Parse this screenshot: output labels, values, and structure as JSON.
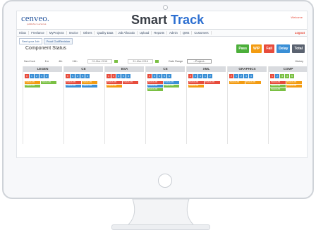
{
  "app": {
    "logo": "cenveo.",
    "logo_sub": "publisher services",
    "title_prefix": "Smart",
    "title_suffix": "Track",
    "user": "Welcome"
  },
  "menu": [
    "Inbox",
    "Freelance",
    "MyProjects",
    "Invoice",
    "Others",
    "Quality Data",
    "Job Allocatio",
    "Upload",
    "Reports",
    "Admin",
    "QMS",
    "Customers"
  ],
  "logout": "Logout",
  "tabs": [
    "Sent your Job",
    "Proof Out/Revision"
  ],
  "section_title": "Component Status",
  "status_buttons": [
    {
      "label": "Pass",
      "color": "#4caf3a"
    },
    {
      "label": "WIP",
      "color": "#f39c12"
    },
    {
      "label": "Fail",
      "color": "#e74c3c"
    },
    {
      "label": "Delay",
      "color": "#3a8fd6"
    },
    {
      "label": "Total",
      "color": "#5a6270"
    }
  ],
  "filters": {
    "f1": "Next 1wk",
    "f2": "1hr",
    "f3": "4th",
    "f4": "11th",
    "date_from": "01-Mar-2016",
    "date_to": "31-Mar-2016",
    "range_label": "Date Range",
    "project_select": "--Project--",
    "history": "History"
  },
  "columns": [
    {
      "name": "LEGEN",
      "nums": [
        "0",
        "1",
        "2",
        "1",
        "2"
      ],
      "num_colors": [
        "#e74c3c",
        "#3a8fd6",
        "#3a8fd6",
        "#3a8fd6",
        "#3a8fd6"
      ],
      "cards": [
        {
          "t": "TRACK-PR",
          "c": "#f39c12"
        },
        {
          "t": "TRACK-PR",
          "c": "#7ac043"
        },
        {
          "t": "TRACK-PR",
          "c": "#7ac043"
        }
      ]
    },
    {
      "name": "CE",
      "nums": [
        "0",
        "1",
        "2",
        "3",
        "4"
      ],
      "num_colors": [
        "#e74c3c",
        "#3a8fd6",
        "#3a8fd6",
        "#3a8fd6",
        "#3a8fd6"
      ],
      "cards": [
        {
          "t": "TRACK-PR",
          "c": "#e74c3c"
        },
        {
          "t": "TRACK-PR",
          "c": "#f39c12"
        },
        {
          "t": "TRACK-PR",
          "c": "#3a8fd6"
        },
        {
          "t": "TRACK-PR",
          "c": "#3a8fd6"
        }
      ]
    },
    {
      "name": "BSA",
      "nums": [
        "1",
        "2",
        "3",
        "0",
        "3"
      ],
      "num_colors": [
        "#e74c3c",
        "#e74c3c",
        "#3a8fd6",
        "#3a8fd6",
        "#3a8fd6"
      ],
      "cards": [
        {
          "t": "TRACK-PR",
          "c": "#e74c3c"
        },
        {
          "t": "TRACK-PR",
          "c": "#e74c3c"
        },
        {
          "t": "TRACK-PR",
          "c": "#f39c12"
        }
      ]
    },
    {
      "name": "CE",
      "nums": [
        "2",
        "3",
        "4",
        "5",
        "6"
      ],
      "num_colors": [
        "#e74c3c",
        "#3a8fd6",
        "#3a8fd6",
        "#3a8fd6",
        "#3a8fd6"
      ],
      "cards": [
        {
          "t": "TRACK-PR",
          "c": "#e74c3c"
        },
        {
          "t": "TRACK-PR",
          "c": "#3a8fd6"
        },
        {
          "t": "TRACK-PR",
          "c": "#3a8fd6"
        },
        {
          "t": "TRACK-PR",
          "c": "#7ac043"
        },
        {
          "t": "TRACK-PR",
          "c": "#7ac043"
        }
      ]
    },
    {
      "name": "XML",
      "nums": [
        "2",
        "3",
        "4",
        "1",
        "2"
      ],
      "num_colors": [
        "#e74c3c",
        "#3a8fd6",
        "#3a8fd6",
        "#3a8fd6",
        "#3a8fd6"
      ],
      "cards": [
        {
          "t": "TRACK-PR",
          "c": "#e74c3c"
        },
        {
          "t": "TRACK-PR",
          "c": "#e74c3c"
        },
        {
          "t": "TRACK-PR",
          "c": "#f39c12"
        }
      ]
    },
    {
      "name": "GRAPHICS",
      "nums": [
        "2",
        "1",
        "2",
        "3",
        "4"
      ],
      "num_colors": [
        "#e74c3c",
        "#3a8fd6",
        "#3a8fd6",
        "#3a8fd6",
        "#3a8fd6"
      ],
      "cards": [
        {
          "t": "TRACK-PR",
          "c": "#f39c12"
        },
        {
          "t": "TRACK-PR",
          "c": "#f39c12"
        }
      ]
    },
    {
      "name": "COMP",
      "nums": [
        "1",
        "2",
        "3",
        "4",
        "5"
      ],
      "num_colors": [
        "#e74c3c",
        "#3a8fd6",
        "#7ac043",
        "#7ac043",
        "#7ac043"
      ],
      "cards": [
        {
          "t": "TRACK-PR",
          "c": "#e74c3c"
        },
        {
          "t": "TRACK-PR",
          "c": "#f39c12"
        },
        {
          "t": "TRACK-PR",
          "c": "#7ac043"
        },
        {
          "t": "TRACK-PR",
          "c": "#f39c12"
        },
        {
          "t": "TRACK-PR",
          "c": "#7ac043"
        }
      ]
    }
  ]
}
